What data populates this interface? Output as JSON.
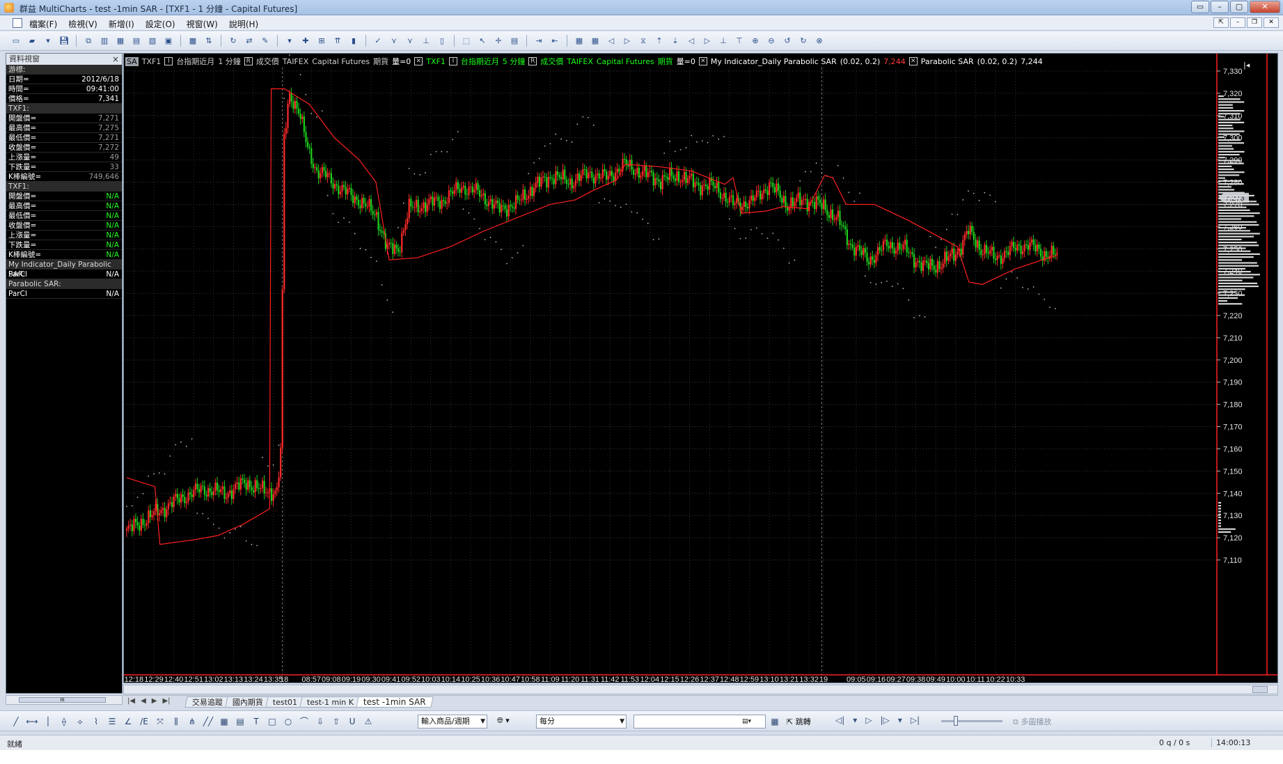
{
  "window": {
    "title": "群益 MultiCharts - test -1min SAR - [TXF1 - 1 分鐘 - Capital Futures]",
    "buttons": [
      "▭",
      "–",
      "▢",
      "✕"
    ]
  },
  "menu": {
    "items": [
      "檔案(F)",
      "檢視(V)",
      "新增(I)",
      "設定(O)",
      "視窗(W)",
      "說明(H)"
    ]
  },
  "data_window": {
    "title": "資料視窗",
    "rows": [
      {
        "label": "游標:",
        "value": "",
        "type": "section"
      },
      {
        "label": "日期=",
        "value": "2012/6/18",
        "type": "white"
      },
      {
        "label": "時間=",
        "value": "09:41:00",
        "type": "white"
      },
      {
        "label": "價格=",
        "value": "7,341",
        "type": "white"
      },
      {
        "label": "TXF1:",
        "value": "",
        "type": "section"
      },
      {
        "label": "開盤價=",
        "value": "7,271",
        "type": "grey"
      },
      {
        "label": "最高價=",
        "value": "7,275",
        "type": "grey"
      },
      {
        "label": "最低價=",
        "value": "7,271",
        "type": "grey"
      },
      {
        "label": "收盤價=",
        "value": "7,272",
        "type": "grey"
      },
      {
        "label": "上漲量=",
        "value": "49",
        "type": "grey"
      },
      {
        "label": "下跌量=",
        "value": "33",
        "type": "grey"
      },
      {
        "label": "K棒編號=",
        "value": "749,646",
        "type": "grey"
      },
      {
        "label": "TXF1:",
        "value": "",
        "type": "section"
      },
      {
        "label": "開盤價=",
        "value": "N/A",
        "type": "green"
      },
      {
        "label": "最高價=",
        "value": "N/A",
        "type": "green"
      },
      {
        "label": "最低價=",
        "value": "N/A",
        "type": "green"
      },
      {
        "label": "收盤價=",
        "value": "N/A",
        "type": "green"
      },
      {
        "label": "上漲量=",
        "value": "N/A",
        "type": "green"
      },
      {
        "label": "下跌量=",
        "value": "N/A",
        "type": "green"
      },
      {
        "label": "K棒編號=",
        "value": "N/A",
        "type": "green"
      },
      {
        "label": "My Indicator_Daily Parabolic SAR:",
        "value": "",
        "type": "section"
      },
      {
        "label": "ParCl",
        "value": "N/A",
        "type": "white"
      },
      {
        "label": "Parabolic SAR:",
        "value": "",
        "type": "section"
      },
      {
        "label": "ParCl",
        "value": "N/A",
        "type": "white"
      }
    ]
  },
  "legend": {
    "sa": "SA",
    "s1_symbol": "TXF1",
    "s1_name": "台指期近月",
    "s1_tf": "1 分鐘",
    "s1_field": "成交價",
    "s1_exch": "TAIFEX",
    "s1_src": "Capital Futures",
    "s1_type": "期貨",
    "s1_vol": "量=0",
    "s2_symbol": "TXF1",
    "s2_name": "台指期近月",
    "s2_tf": "5 分鐘",
    "s2_field": "成交價",
    "s2_exch": "TAIFEX",
    "s2_src": "Capital Futures",
    "s2_type": "期貨",
    "s2_vol": "量=0",
    "ind1_name": "My Indicator_Daily Parabolic SAR",
    "ind1_params": "(0.02,  0.2)",
    "ind1_value": "7,244",
    "ind2_name": "Parabolic SAR",
    "ind2_params": "(0.02,  0.2)",
    "ind2_value": "7,244"
  },
  "chart_data": {
    "type": "candlestick",
    "price_axis": {
      "ticks": [
        7110,
        7120,
        7130,
        7140,
        7150,
        7160,
        7170,
        7180,
        7190,
        7200,
        7210,
        7220,
        7230,
        7240,
        7250,
        7260,
        7270,
        7280,
        7290,
        7300,
        7310,
        7320,
        7330
      ],
      "tick_labels": [
        "7,110",
        "7,120",
        "7,130",
        "7,140",
        "7,150",
        "7,160",
        "7,170",
        "7,180",
        "7,190",
        "7,200",
        "7,210",
        "7,220",
        "7,230",
        "7,240",
        "7,250",
        "7,260",
        "7,270",
        "7,280",
        "7,290",
        "7,300",
        "7,310",
        "7,320",
        "7,330"
      ],
      "range": [
        7105,
        7338
      ],
      "last_price_marker": "7,273"
    },
    "time_axis": {
      "labels": [
        "12:18",
        "12:29",
        "12:40",
        "12:51",
        "13:02",
        "13:13",
        "13:24",
        "13:35",
        "18",
        "08:57",
        "09:08",
        "09:19",
        "09:30",
        "09:41",
        "09:52",
        "10:03",
        "10:14",
        "10:25",
        "10:36",
        "10:47",
        "10:58",
        "11:09",
        "11:20",
        "11:31",
        "11:42",
        "11:53",
        "12:04",
        "12:15",
        "12:26",
        "12:37",
        "12:48",
        "12:59",
        "13:10",
        "13:21",
        "13:32",
        "19",
        "09:05",
        "09:16",
        "09:27",
        "09:38",
        "09:49",
        "10:00",
        "10:11",
        "10:22",
        "10:33"
      ],
      "label_index": [
        4,
        15,
        26,
        37,
        48,
        59,
        70,
        81,
        87,
        102,
        113,
        124,
        135,
        146,
        157,
        168,
        179,
        190,
        201,
        212,
        223,
        234,
        245,
        256,
        267,
        278,
        289,
        300,
        311,
        322,
        333,
        344,
        355,
        366,
        377,
        385,
        403,
        414,
        425,
        436,
        447,
        458,
        469,
        480,
        491
      ],
      "session_breaks": [
        86,
        384
      ]
    },
    "close_anchors": [
      [
        0,
        7123
      ],
      [
        10,
        7128
      ],
      [
        20,
        7133
      ],
      [
        30,
        7138
      ],
      [
        42,
        7142
      ],
      [
        55,
        7140
      ],
      [
        66,
        7145
      ],
      [
        75,
        7141
      ],
      [
        83,
        7141
      ],
      [
        85,
        7158
      ],
      [
        87,
        7300
      ],
      [
        90,
        7320
      ],
      [
        95,
        7312
      ],
      [
        100,
        7295
      ],
      [
        105,
        7285
      ],
      [
        110,
        7283
      ],
      [
        118,
        7277
      ],
      [
        128,
        7272
      ],
      [
        138,
        7265
      ],
      [
        144,
        7250
      ],
      [
        150,
        7250
      ],
      [
        156,
        7268
      ],
      [
        165,
        7270
      ],
      [
        175,
        7272
      ],
      [
        185,
        7278
      ],
      [
        195,
        7275
      ],
      [
        205,
        7268
      ],
      [
        215,
        7270
      ],
      [
        225,
        7278
      ],
      [
        235,
        7283
      ],
      [
        245,
        7280
      ],
      [
        255,
        7284
      ],
      [
        265,
        7282
      ],
      [
        275,
        7288
      ],
      [
        285,
        7284
      ],
      [
        295,
        7281
      ],
      [
        305,
        7283
      ],
      [
        315,
        7279
      ],
      [
        325,
        7278
      ],
      [
        335,
        7270
      ],
      [
        345,
        7271
      ],
      [
        355,
        7279
      ],
      [
        365,
        7270
      ],
      [
        375,
        7272
      ],
      [
        385,
        7269
      ],
      [
        393,
        7263
      ],
      [
        400,
        7252
      ],
      [
        410,
        7245
      ],
      [
        420,
        7252
      ],
      [
        430,
        7250
      ],
      [
        440,
        7242
      ],
      [
        450,
        7243
      ],
      [
        460,
        7250
      ],
      [
        465,
        7258
      ],
      [
        472,
        7250
      ],
      [
        480,
        7246
      ],
      [
        490,
        7250
      ],
      [
        498,
        7252
      ],
      [
        506,
        7248
      ],
      [
        514,
        7247
      ]
    ],
    "sar_1min_dotted": "white dotted series tracking price (Parabolic SAR)",
    "daily_sar_red_line": [
      [
        0,
        7147
      ],
      [
        17,
        7143
      ],
      [
        20,
        7117
      ],
      [
        40,
        7119
      ],
      [
        55,
        7121
      ],
      [
        70,
        7126
      ],
      [
        86,
        7133
      ],
      [
        87,
        7322
      ],
      [
        95,
        7322
      ],
      [
        110,
        7315
      ],
      [
        125,
        7300
      ],
      [
        140,
        7290
      ],
      [
        150,
        7280
      ],
      [
        158,
        7245
      ],
      [
        175,
        7246
      ],
      [
        195,
        7251
      ],
      [
        215,
        7258
      ],
      [
        235,
        7264
      ],
      [
        255,
        7270
      ],
      [
        270,
        7272
      ],
      [
        280,
        7276
      ],
      [
        295,
        7281
      ],
      [
        300,
        7288
      ],
      [
        320,
        7287
      ],
      [
        340,
        7285
      ],
      [
        360,
        7279
      ],
      [
        365,
        7282
      ],
      [
        370,
        7266
      ],
      [
        385,
        7267
      ],
      [
        395,
        7269
      ],
      [
        410,
        7268
      ],
      [
        420,
        7283
      ],
      [
        425,
        7282
      ],
      [
        433,
        7270
      ],
      [
        450,
        7270
      ],
      [
        470,
        7263
      ],
      [
        490,
        7255
      ],
      [
        500,
        7251
      ],
      [
        507,
        7235
      ],
      [
        515,
        7234
      ],
      [
        535,
        7241
      ],
      [
        555,
        7246
      ],
      [
        560,
        7247
      ]
    ]
  },
  "tabs": {
    "items": [
      "交易追蹤",
      "國內期貨",
      "test01",
      "test-1 min K",
      "test -1min SAR"
    ],
    "active": 4,
    "nav": [
      "|◀",
      "◀",
      "▶",
      "▶|"
    ]
  },
  "bottom_toolbar": {
    "symbol_combo": "輸入商品/週期",
    "interval_combo": "每分",
    "search_value": "",
    "jump_label": "跳轉",
    "multi_label": "多圖播放"
  },
  "status": {
    "left": "就緒",
    "queue": "0 q / 0 s",
    "time": "14:00:13"
  }
}
